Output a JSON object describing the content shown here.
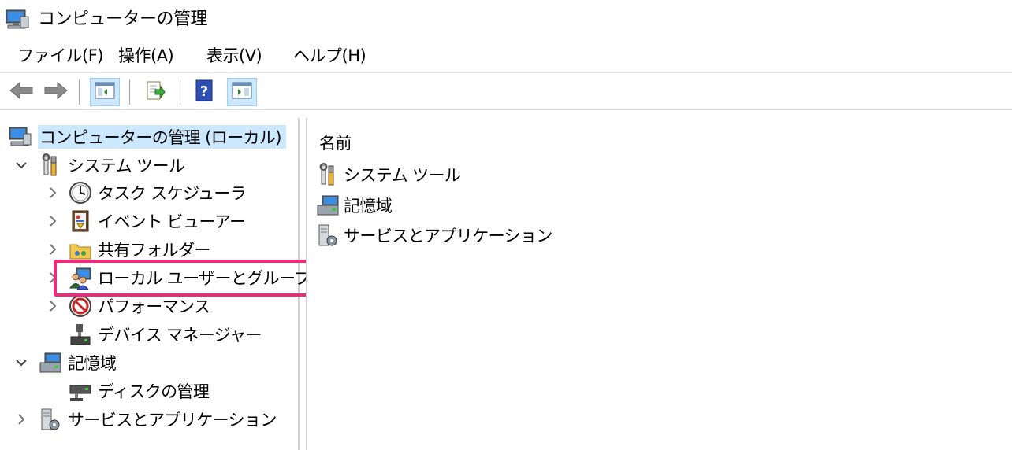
{
  "window": {
    "title": "コンピューターの管理",
    "icon": "computer-management-icon"
  },
  "menu": {
    "items": [
      {
        "label": "ファイル(F)"
      },
      {
        "label": "操作(A)"
      },
      {
        "label": "表示(V)"
      },
      {
        "label": "ヘルプ(H)"
      }
    ]
  },
  "toolbar": {
    "buttons": [
      {
        "icon": "back-arrow-icon"
      },
      {
        "icon": "forward-arrow-icon"
      },
      {
        "icon": "show-hide-console-tree-icon",
        "active": true
      },
      {
        "icon": "export-list-icon"
      },
      {
        "icon": "help-icon"
      },
      {
        "icon": "show-hide-action-pane-icon",
        "active": true
      }
    ]
  },
  "tree": {
    "root": {
      "label": "コンピューターの管理 (ローカル)",
      "selected": true
    },
    "items": [
      {
        "label": "システム ツール",
        "expanded": true,
        "icon": "tools-icon"
      },
      {
        "label": "タスク スケジューラ",
        "icon": "clock-icon"
      },
      {
        "label": "イベント ビューアー",
        "icon": "event-viewer-icon"
      },
      {
        "label": "共有フォルダー",
        "icon": "shared-folder-icon"
      },
      {
        "label": "ローカル ユーザーとグループ",
        "icon": "users-icon",
        "highlighted": true
      },
      {
        "label": "パフォーマンス",
        "icon": "performance-icon"
      },
      {
        "label": "デバイス マネージャー",
        "icon": "device-manager-icon"
      },
      {
        "label": "記憶域",
        "expanded": true,
        "icon": "storage-icon"
      },
      {
        "label": "ディスクの管理",
        "icon": "disk-icon"
      },
      {
        "label": "サービスとアプリケーション",
        "icon": "services-icon"
      }
    ]
  },
  "list": {
    "column_header": "名前",
    "rows": [
      {
        "label": "システム ツール",
        "icon": "tools-icon"
      },
      {
        "label": "記憶域",
        "icon": "storage-icon"
      },
      {
        "label": "サービスとアプリケーション",
        "icon": "services-icon"
      }
    ]
  },
  "colors": {
    "selection": "#cce8ff",
    "highlight_border": "#ee2a7b",
    "toolbar_active": "#cde8ff"
  }
}
